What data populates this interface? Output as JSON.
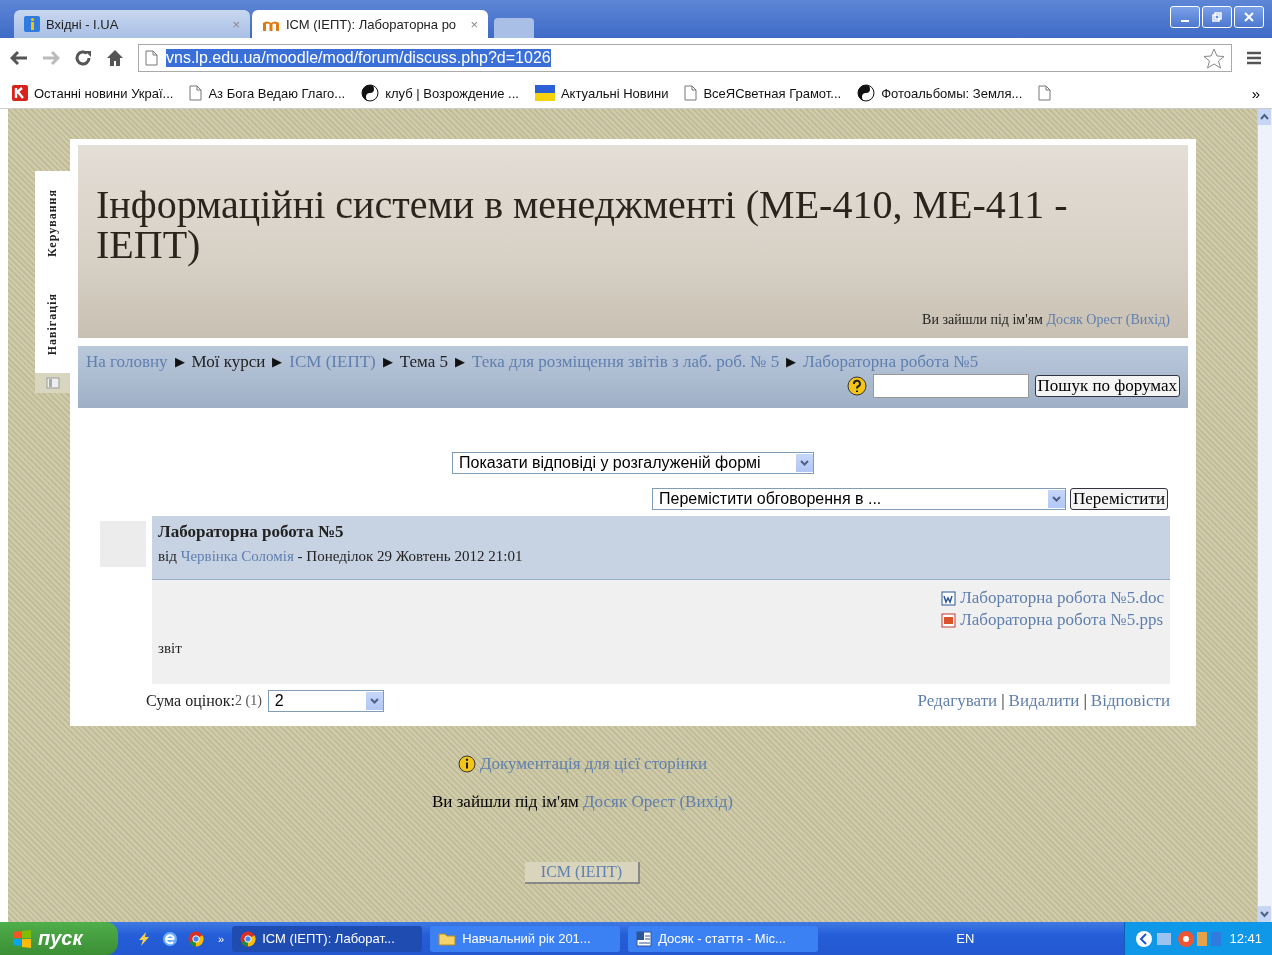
{
  "browser": {
    "tabs": [
      {
        "title": "Вхідні - I.UA",
        "kind": "info",
        "selected": false,
        "close": "×"
      },
      {
        "title": "ІСМ (ІЕПТ): Лабораторна ро",
        "kind": "moodle",
        "selected": true,
        "close": "×"
      }
    ],
    "url": "vns.lp.edu.ua/moodle/mod/forum/discuss.php?d=1026",
    "bookmarks": [
      {
        "label": "Останні новини Украї...",
        "kind": "k"
      },
      {
        "label": "Аз Бога Ведаю Глаго...",
        "kind": "page"
      },
      {
        "label": "клуб | Возрождение ...",
        "kind": "yin"
      },
      {
        "label": "Актуальні Новини",
        "kind": "flag"
      },
      {
        "label": "ВсеЯСветная Грамот...",
        "kind": "page"
      },
      {
        "label": "Фотоальбомы: Земля...",
        "kind": "yin"
      },
      {
        "kind": "page"
      }
    ],
    "bookmarks_more": "»"
  },
  "block_tabs": [
    {
      "label": "Керування"
    },
    {
      "label": "Навігація"
    }
  ],
  "header": {
    "title": "Інформаційні системи в менеджменті (МЕ-410, МЕ-411 - ІЕПТ)",
    "login_text": "Ви зайшли під ім'ям",
    "user": "Досяк Орест",
    "logout": "(Вихід)"
  },
  "breadcrumb": [
    {
      "label": "На головну",
      "link": true
    },
    {
      "sep": "▶",
      "label": "Мої курси",
      "link": false
    },
    {
      "sep": "▶",
      "label": "ІСМ (ІЕПТ)",
      "link": true
    },
    {
      "sep": "▶",
      "label": "Тема 5",
      "link": false
    },
    {
      "sep": "▶",
      "label": "Тека для розміщення звітів з лаб. роб. № 5",
      "link": true
    },
    {
      "sep": "▶",
      "label": "Лабораторна робота №5",
      "link": true
    }
  ],
  "search": {
    "button": "Пошук по форумах"
  },
  "display_mode": "Показати відповіді у розгалуженій формі",
  "move": {
    "select": "Перемістити обговорення в ...",
    "button": "Перемістити"
  },
  "post": {
    "subject": "Лабораторна робота №5",
    "by": "від",
    "author": "Червінка Соломія",
    "date": "- Понеділок 29 Жовтень 2012 21:01",
    "attachments": [
      {
        "name": "Лабораторна робота №5.doc",
        "kind": "doc"
      },
      {
        "name": "Лабораторна робота №5.pps",
        "kind": "pps"
      }
    ],
    "body": "звіт",
    "rating_label": "Сума оцінок:",
    "rating_value": "2 (1)",
    "rating_select": "2",
    "commands": [
      {
        "label": "Редагувати"
      },
      {
        "sep": "|",
        "label": "Видалити"
      },
      {
        "sep": "|",
        "label": "Відповісти"
      }
    ]
  },
  "footer": {
    "doc_link": "Документація для цієї сторінки",
    "login_text": "Ви зайшли під ім'ям",
    "user": "Досяк Орест",
    "logout": "(Вихід)",
    "course_button": "ІСМ (ІЕПТ)"
  },
  "taskbar": {
    "start": "пуск",
    "more": "»",
    "tasks": [
      {
        "label": "ІСМ (ІЕПТ): Лаборат...",
        "kind": "chrome",
        "selected": true
      },
      {
        "label": "Навчальний рік 201...",
        "kind": "folder",
        "selected": false
      },
      {
        "label": "Досяк - стаття - Mic...",
        "kind": "word",
        "selected": false
      }
    ],
    "lang": "EN",
    "time": "12:41"
  }
}
